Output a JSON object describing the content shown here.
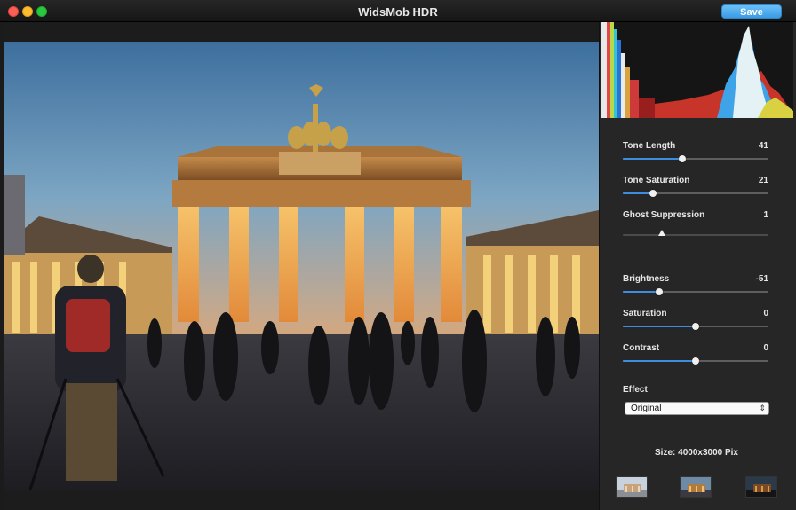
{
  "window": {
    "title": "WidsMob HDR"
  },
  "toolbar": {
    "save_label": "Save"
  },
  "controls": [
    {
      "key": "tone-length",
      "label": "Tone Length",
      "value": "41",
      "level": 0.41,
      "kind": "slider"
    },
    {
      "key": "tone-saturation",
      "label": "Tone Saturation",
      "value": "21",
      "level": 0.21,
      "kind": "slider"
    },
    {
      "key": "ghost-suppression",
      "label": "Ghost Suppression",
      "value": "1",
      "level": 0.27,
      "kind": "ticked"
    },
    {
      "key": "brightness",
      "label": "Brightness",
      "value": "-51",
      "level": 0.25,
      "kind": "slider"
    },
    {
      "key": "saturation",
      "label": "Saturation",
      "value": "0",
      "level": 0.5,
      "kind": "slider"
    },
    {
      "key": "contrast",
      "label": "Contrast",
      "value": "0",
      "level": 0.5,
      "kind": "slider"
    }
  ],
  "effect": {
    "label": "Effect",
    "selected": "Original"
  },
  "image_info": {
    "size_text": "Size: 4000x3000 Pix"
  },
  "thumbnails": [
    {
      "name": "exposure-under"
    },
    {
      "name": "exposure-normal"
    },
    {
      "name": "exposure-over"
    }
  ],
  "colors": {
    "accent": "#3d8ee0",
    "save_button": "#4aa8ee",
    "panel": "#262626"
  }
}
